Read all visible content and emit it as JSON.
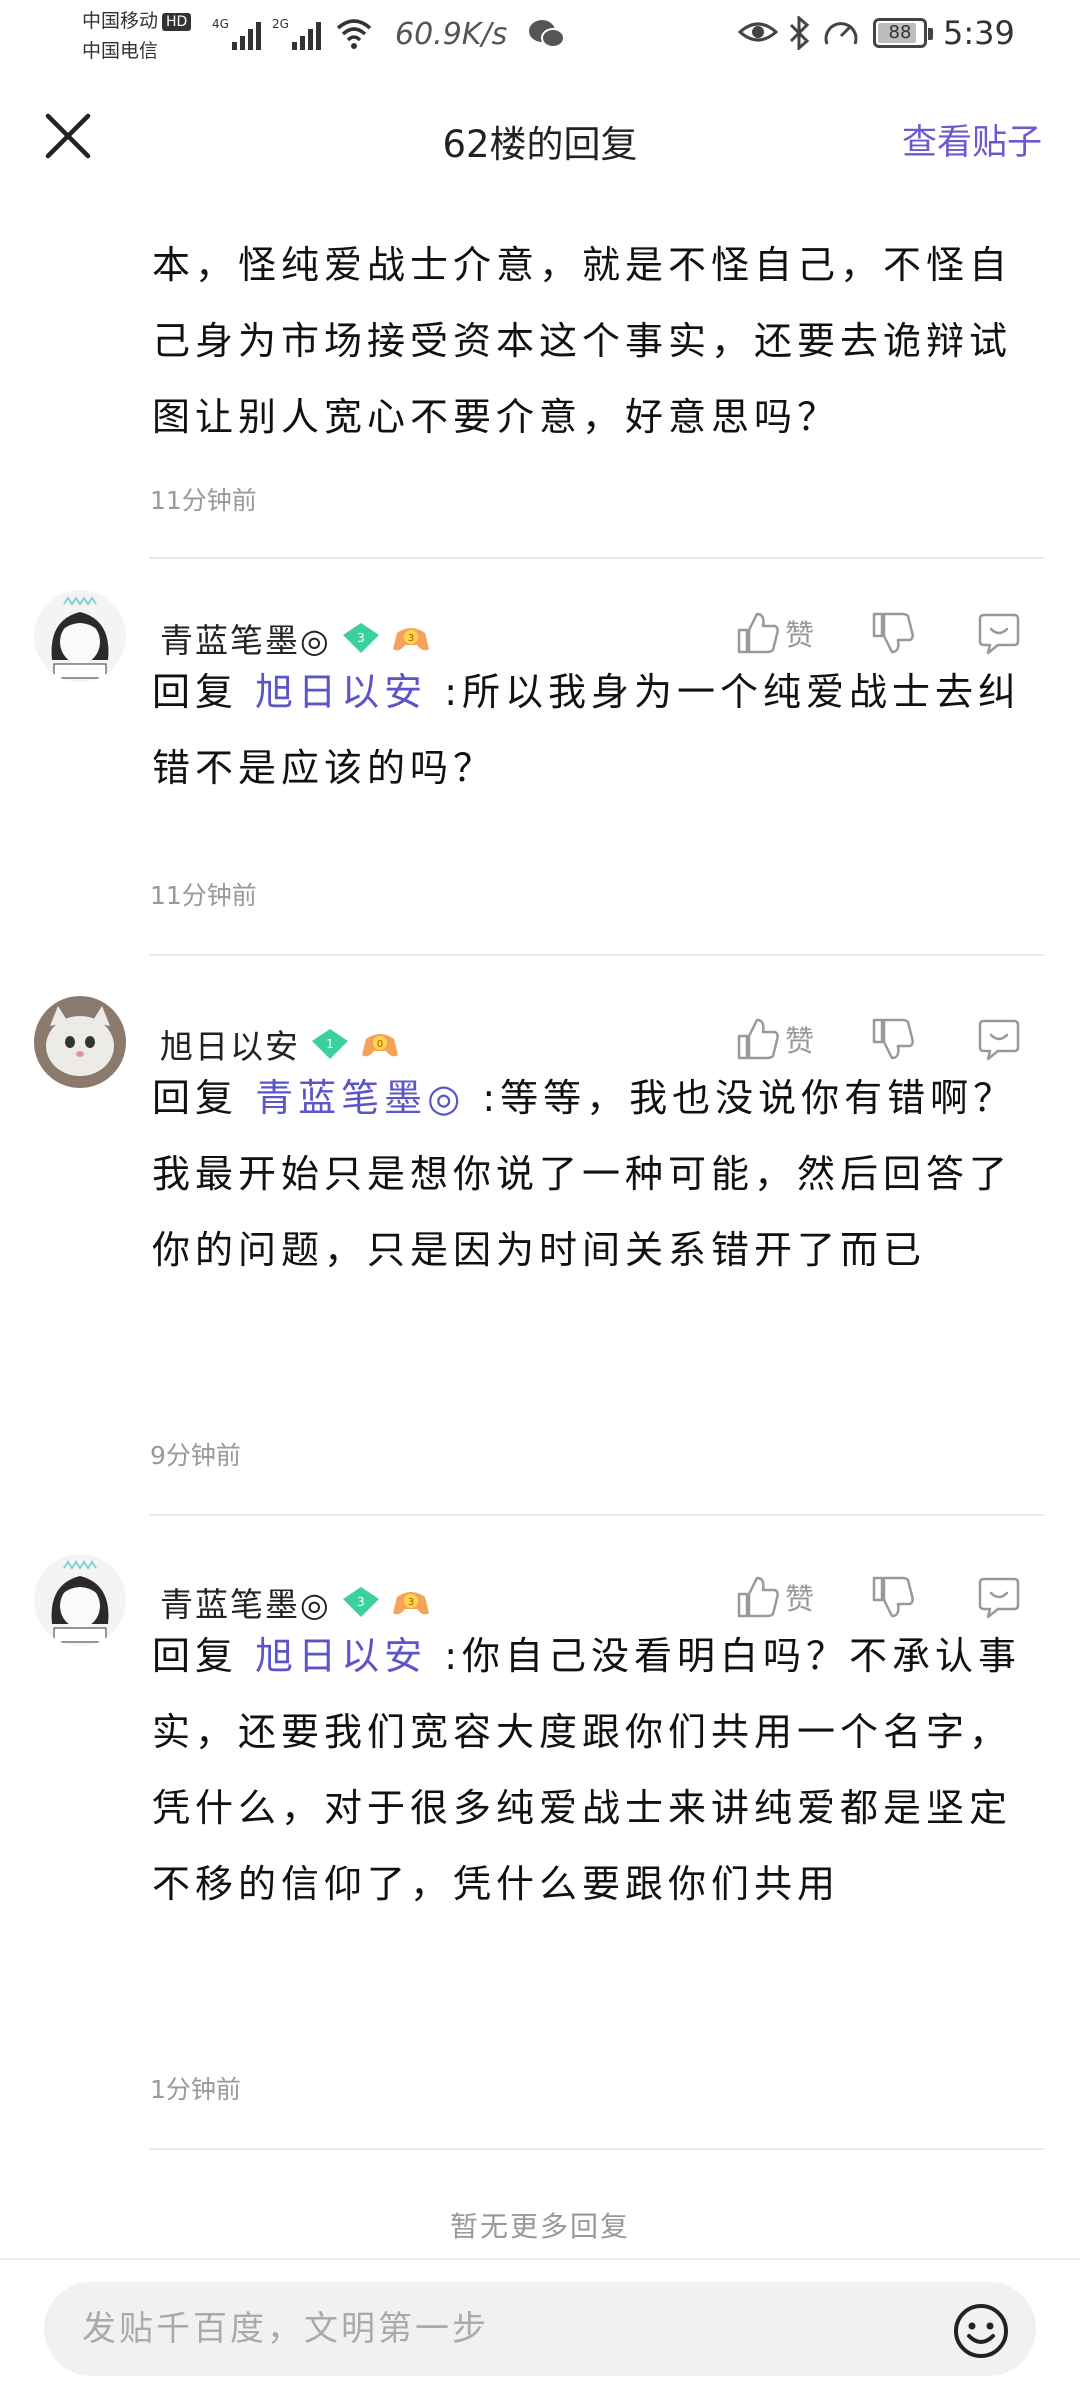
{
  "status_bar": {
    "carrier1": "中国移动",
    "carrier1_badge": "HD",
    "carrier2": "中国电信",
    "net1": "4G",
    "net2": "2G",
    "speed": "60.9K/s",
    "battery": "88",
    "battery_level_percent": 88,
    "time": "5:39"
  },
  "header": {
    "title": "62楼的回复",
    "view_post": "查看贴子"
  },
  "top_comment": {
    "text": "本，怪纯爱战士介意，就是不怪自己，不怪自己身为市场接受资本这个事实，还要去诡辩试图让别人宽心不要介意，好意思吗？",
    "time": "11分钟前"
  },
  "replies": [
    {
      "user": "青蓝笔墨◎",
      "level": "3",
      "badge_value": "3",
      "like_label": "赞",
      "prefix": "回复",
      "mention": "旭日以安",
      "text": " :所以我身为一个纯爱战士去纠错不是应该的吗？",
      "time": "11分钟前"
    },
    {
      "user": "旭日以安",
      "level": "1",
      "badge_value": "0",
      "like_label": "赞",
      "prefix": "回复",
      "mention": "青蓝笔墨◎",
      "text": " :等等，我也没说你有错啊？我最开始只是想你说了一种可能，然后回答了你的问题，只是因为时间关系错开了而已",
      "time": "9分钟前"
    },
    {
      "user": "青蓝笔墨◎",
      "level": "3",
      "badge_value": "3",
      "like_label": "赞",
      "prefix": "回复",
      "mention": "旭日以安",
      "text": " :你自己没看明白吗？不承认事实，还要我们宽容大度跟你们共用一个名字，凭什么，对于很多纯爱战士来讲纯爱都是坚定不移的信仰了，凭什么要跟你们共用",
      "time": "1分钟前"
    }
  ],
  "footer": {
    "no_more": "暂无更多回复",
    "input_placeholder": "发贴千百度，文明第一步"
  },
  "colors": {
    "accent": "#5b55c9",
    "muted": "#999999",
    "green_badge": "#3ccfa0",
    "orange_badge": "#f5a25a"
  }
}
